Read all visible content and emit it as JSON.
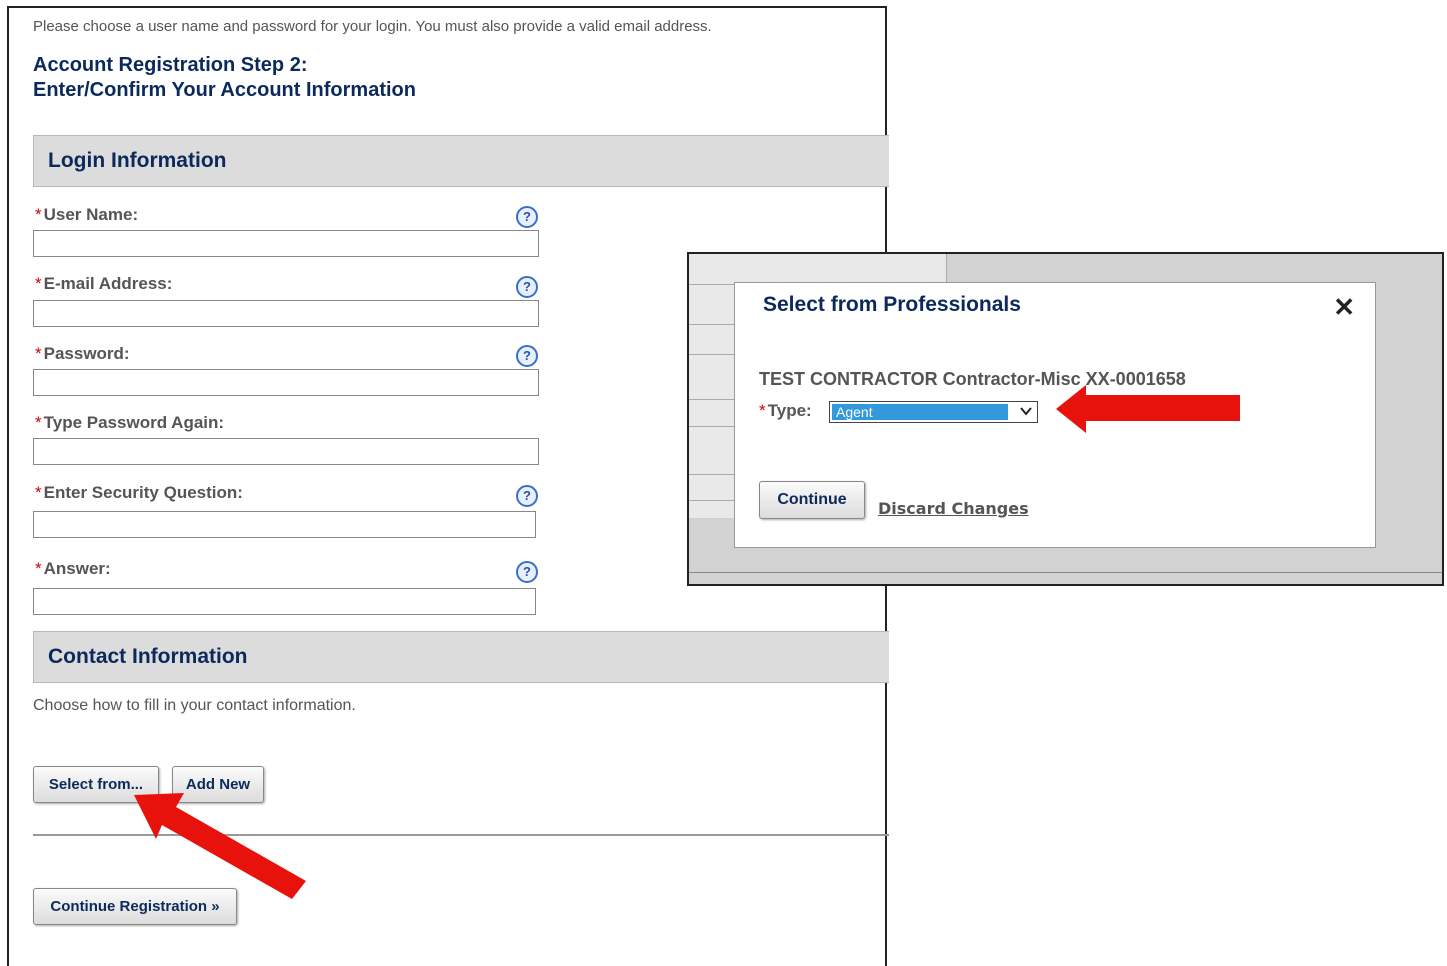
{
  "intro_text": "Please choose a user name and password for your login. You must also provide a valid email address.",
  "step_title_line1": "Account Registration Step 2:",
  "step_title_line2": "Enter/Confirm Your Account Information",
  "login_section": {
    "title": "Login Information",
    "required_marker": "*",
    "help_glyph": "?",
    "fields": [
      {
        "label": "User Name:",
        "value": "",
        "has_help": true
      },
      {
        "label": "E-mail Address:",
        "value": "",
        "has_help": true
      },
      {
        "label": "Password:",
        "value": "",
        "has_help": true
      },
      {
        "label": "Type Password Again:",
        "value": "",
        "has_help": false
      },
      {
        "label": "Enter Security Question:",
        "value": "",
        "has_help": true
      },
      {
        "label": "Answer:",
        "value": "",
        "has_help": true
      }
    ]
  },
  "contact_section": {
    "title": "Contact Information",
    "description": "Choose how to fill in your contact information.",
    "select_button": "Select from...",
    "add_button": "Add New"
  },
  "continue_registration_button": "Continue Registration »",
  "dialog": {
    "title": "Select from Professionals",
    "close_glyph": "✕",
    "professional": "TEST CONTRACTOR Contractor-Misc XX-0001658",
    "type_label": "Type:",
    "type_value": "Agent",
    "continue_button": "Continue",
    "discard_link": "Discard Changes"
  },
  "colors": {
    "heading": "#0b2a5b",
    "section_bg": "#dcdcdc",
    "required": "#cc0000",
    "annotation_arrow": "#e8120c",
    "select_highlight": "#3399dd"
  }
}
